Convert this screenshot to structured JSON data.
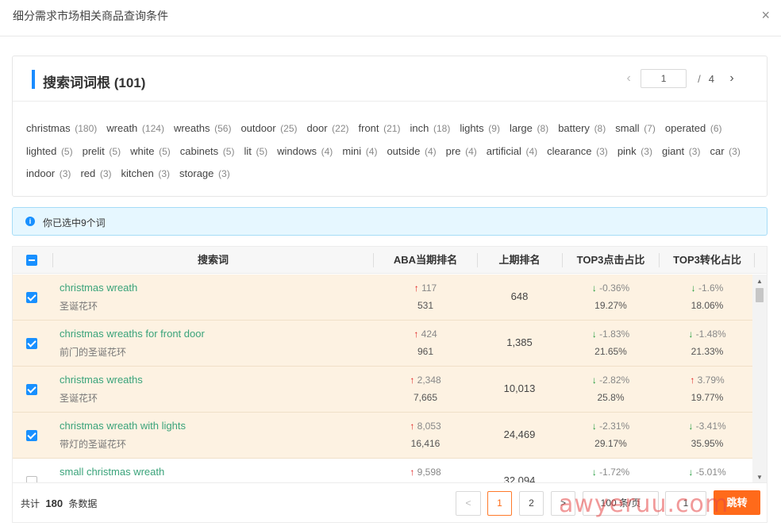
{
  "modal": {
    "title": "细分需求市场相关商品查询条件",
    "close_glyph": "×"
  },
  "roots": {
    "title": "搜索词词根",
    "count": "(101)",
    "pager": {
      "prev": "‹",
      "current": "1",
      "slash": "/",
      "total": "4",
      "next": "›"
    },
    "tags": [
      {
        "word": "christmas",
        "n": "(180)"
      },
      {
        "word": "wreath",
        "n": "(124)"
      },
      {
        "word": "wreaths",
        "n": "(56)"
      },
      {
        "word": "outdoor",
        "n": "(25)"
      },
      {
        "word": "door",
        "n": "(22)"
      },
      {
        "word": "front",
        "n": "(21)"
      },
      {
        "word": "inch",
        "n": "(18)"
      },
      {
        "word": "lights",
        "n": "(9)"
      },
      {
        "word": "large",
        "n": "(8)"
      },
      {
        "word": "battery",
        "n": "(8)"
      },
      {
        "word": "small",
        "n": "(7)"
      },
      {
        "word": "operated",
        "n": "(6)"
      },
      {
        "word": "lighted",
        "n": "(5)"
      },
      {
        "word": "prelit",
        "n": "(5)"
      },
      {
        "word": "white",
        "n": "(5)"
      },
      {
        "word": "cabinets",
        "n": "(5)"
      },
      {
        "word": "lit",
        "n": "(5)"
      },
      {
        "word": "windows",
        "n": "(4)"
      },
      {
        "word": "mini",
        "n": "(4)"
      },
      {
        "word": "outside",
        "n": "(4)"
      },
      {
        "word": "pre",
        "n": "(4)"
      },
      {
        "word": "artificial",
        "n": "(4)"
      },
      {
        "word": "clearance",
        "n": "(3)"
      },
      {
        "word": "pink",
        "n": "(3)"
      },
      {
        "word": "giant",
        "n": "(3)"
      },
      {
        "word": "car",
        "n": "(3)"
      },
      {
        "word": "indoor",
        "n": "(3)"
      },
      {
        "word": "red",
        "n": "(3)"
      },
      {
        "word": "kitchen",
        "n": "(3)"
      },
      {
        "word": "storage",
        "n": "(3)"
      }
    ]
  },
  "info": {
    "icon": "i",
    "text": "你已选中9个词"
  },
  "table": {
    "headers": [
      "搜索词",
      "ABA当期排名",
      "上期排名",
      "TOP3点击占比",
      "TOP3转化占比"
    ],
    "rows": [
      {
        "selected": true,
        "keyword": "christmas wreath",
        "cn": "圣诞花环",
        "rank_dir": "up",
        "rank_delta": "117",
        "rank": "531",
        "prev_rank": "648",
        "click_dir": "down",
        "click_delta": "-0.36%",
        "click": "19.27%",
        "conv_dir": "down",
        "conv_delta": "-1.6%",
        "conv": "18.06%"
      },
      {
        "selected": true,
        "keyword": "christmas wreaths for front door",
        "cn": "前门的圣诞花环",
        "rank_dir": "up",
        "rank_delta": "424",
        "rank": "961",
        "prev_rank": "1,385",
        "click_dir": "down",
        "click_delta": "-1.83%",
        "click": "21.65%",
        "conv_dir": "down",
        "conv_delta": "-1.48%",
        "conv": "21.33%"
      },
      {
        "selected": true,
        "keyword": "christmas wreaths",
        "cn": "圣诞花环",
        "rank_dir": "up",
        "rank_delta": "2,348",
        "rank": "7,665",
        "prev_rank": "10,013",
        "click_dir": "down",
        "click_delta": "-2.82%",
        "click": "25.8%",
        "conv_dir": "up",
        "conv_delta": "3.79%",
        "conv": "19.77%"
      },
      {
        "selected": true,
        "keyword": "christmas wreath with lights",
        "cn": "带灯的圣诞花环",
        "rank_dir": "up",
        "rank_delta": "8,053",
        "rank": "16,416",
        "prev_rank": "24,469",
        "click_dir": "down",
        "click_delta": "-2.31%",
        "click": "29.17%",
        "conv_dir": "down",
        "conv_delta": "-3.41%",
        "conv": "35.95%"
      },
      {
        "selected": false,
        "keyword": "small christmas wreath",
        "cn": "",
        "rank_dir": "up",
        "rank_delta": "9,598",
        "rank": "",
        "prev_rank": "32,094",
        "click_dir": "down",
        "click_delta": "-1.72%",
        "click": "",
        "conv_dir": "down",
        "conv_delta": "-5.01%",
        "conv": ""
      }
    ]
  },
  "footer": {
    "total_prefix": "共计",
    "total": "180",
    "total_suffix": "条数据",
    "prev": "<",
    "pages": [
      "1",
      "2"
    ],
    "next": ">",
    "page_size": "100 条/页",
    "jump_value": "1",
    "jump_label": "跳转"
  },
  "watermark": "awyeruu.com",
  "colors": {
    "accent": "#1890ff",
    "orange": "#ff6a1a",
    "up": "#e02020",
    "down": "#1f9a3a",
    "keyword": "#3aa37a",
    "selected_row": "#fdf2e2"
  }
}
